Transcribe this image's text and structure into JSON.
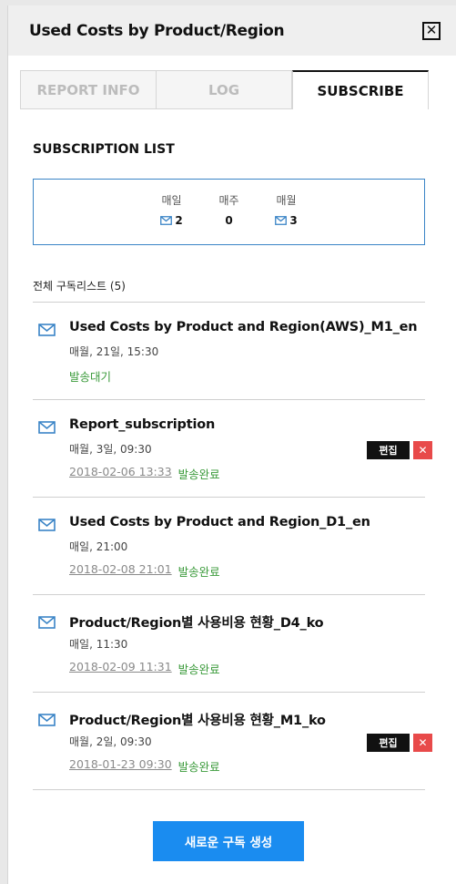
{
  "header": {
    "title": "Used Costs by Product/Region",
    "close_label": "✕"
  },
  "tabs": [
    {
      "label": "REPORT INFO",
      "active": false
    },
    {
      "label": "LOG",
      "active": false
    },
    {
      "label": "SUBSCRIBE",
      "active": true
    }
  ],
  "subscription": {
    "section_title": "SUBSCRIPTION LIST",
    "summary": [
      {
        "label": "매일",
        "value": "2",
        "icon": "mail-icon"
      },
      {
        "label": "매주",
        "value": "0",
        "icon": ""
      },
      {
        "label": "매월",
        "value": "3",
        "icon": "mail-icon"
      }
    ],
    "list_header": "전체 구독리스트 (5)",
    "items": [
      {
        "title": "Used Costs by Product and Region(AWS)_M1_en",
        "schedule": "매월, 21일, 15:30",
        "date": "",
        "status": "발송대기",
        "editable": false
      },
      {
        "title": "Report_subscription",
        "schedule": "매월, 3일, 09:30",
        "date": "2018-02-06 13:33",
        "status": "발송완료",
        "editable": true
      },
      {
        "title": "Used Costs by Product and Region_D1_en",
        "schedule": "매일, 21:00",
        "date": "2018-02-08 21:01",
        "status": "발송완료",
        "editable": false
      },
      {
        "title": "Product/Region별 사용비용 현황_D4_ko",
        "schedule": "매일, 11:30",
        "date": "2018-02-09 11:31",
        "status": "발송완료",
        "editable": false
      },
      {
        "title": "Product/Region별 사용비용 현황_M1_ko",
        "schedule": "매월, 2일, 09:30",
        "date": "2018-01-23 09:30",
        "status": "발송완료",
        "editable": true
      }
    ],
    "edit_label": "편집",
    "delete_label": "✕",
    "create_label": "새로운 구독 생성"
  },
  "colors": {
    "accent": "#1a8cf0",
    "status_green": "#3a9a3a",
    "delete_red": "#e84a4a",
    "box_border": "#3a84c6"
  }
}
